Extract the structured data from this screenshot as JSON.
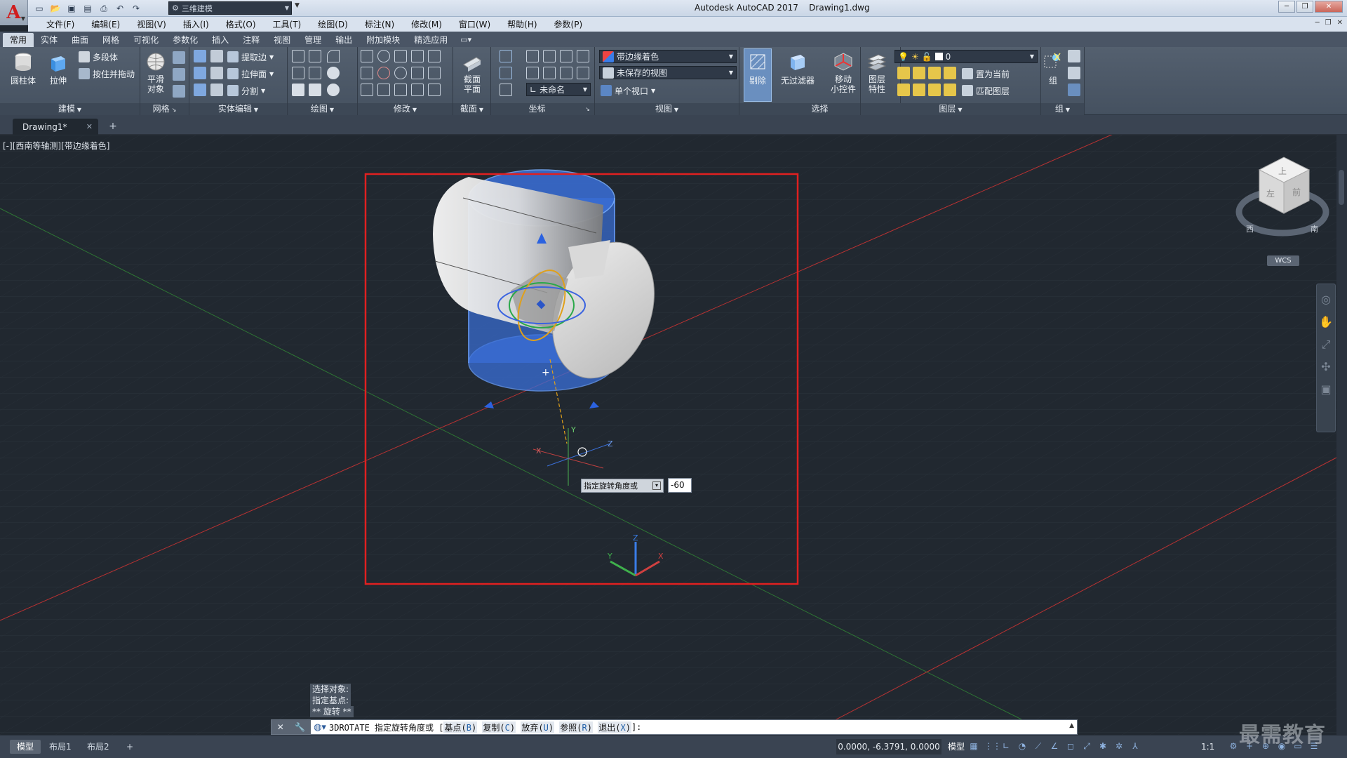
{
  "titlebar": {
    "logo": "A",
    "workspace": "三维建模",
    "title": "Autodesk AutoCAD 2017    Drawing1.dwg"
  },
  "menu": [
    "文件(F)",
    "编辑(E)",
    "视图(V)",
    "插入(I)",
    "格式(O)",
    "工具(T)",
    "绘图(D)",
    "标注(N)",
    "修改(M)",
    "窗口(W)",
    "帮助(H)",
    "参数(P)"
  ],
  "ribbon_tabs": [
    "常用",
    "实体",
    "曲面",
    "网格",
    "可视化",
    "参数化",
    "插入",
    "注释",
    "视图",
    "管理",
    "输出",
    "附加模块",
    "精选应用"
  ],
  "ribbon": {
    "modeling": {
      "title": "建模",
      "cylinder": "圆柱体",
      "extrude": "拉伸",
      "polysolid": "多段体",
      "presspull": "按住并拖动"
    },
    "mesh": {
      "title": "网格",
      "smooth": "平滑\n对象"
    },
    "solid_edit": {
      "title": "实体编辑",
      "extract_edges": "提取边",
      "extrude_faces": "拉伸面",
      "separate": "分割"
    },
    "draw": {
      "title": "绘图"
    },
    "modify": {
      "title": "修改"
    },
    "section": {
      "title": "截面",
      "section_plane": "截面\n平面"
    },
    "coordinates": {
      "title": "坐标",
      "ucs_combo": "未命名"
    },
    "view": {
      "title": "视图",
      "visual_style": "带边缘着色",
      "saved_view": "未保存的视图",
      "single_viewport": "单个视口"
    },
    "selection": {
      "title": "选择",
      "cull": "剔除",
      "no_filter": "无过滤器"
    },
    "gizmo": {
      "move_gizmo": "移动\n小控件"
    },
    "layers": {
      "title": "图层",
      "layer_props": "图层\n特性",
      "layer_combo": "0",
      "set_current": "置为当前",
      "match_layer": "匹配图层"
    },
    "groups": {
      "title": "组",
      "group": "组"
    }
  },
  "doc_tab": {
    "name": "Drawing1*"
  },
  "viewport": {
    "label": "[-][西南等轴测][带边缘着色]",
    "wcs": "WCS",
    "ucs_axes": {
      "x": "X",
      "y": "Y",
      "z": "Z"
    },
    "viewcube": {
      "top": "上",
      "front": "前",
      "left": "左",
      "west": "西",
      "south": "南"
    }
  },
  "dynamic_input": {
    "prompt": "指定旋转角度或",
    "value": "-60"
  },
  "command_history": [
    "选择对象:",
    "指定基点:",
    "** 旋转 **"
  ],
  "command_line": {
    "prefix": "3DROTATE 指定旋转角度或 [",
    "options": [
      {
        "label": "基点(",
        "key": "B",
        "end": ")"
      },
      {
        "label": "复制(",
        "key": "C",
        "end": ")"
      },
      {
        "label": "放弃(",
        "key": "U",
        "end": ")"
      },
      {
        "label": "参照(",
        "key": "R",
        "end": ")"
      },
      {
        "label": "退出(",
        "key": "X",
        "end": ")"
      }
    ],
    "suffix": "]:"
  },
  "layout_tabs": [
    "模型",
    "布局1",
    "布局2"
  ],
  "status": {
    "coords": "0.0000, -6.3791, 0.0000",
    "model": "模型",
    "scale": "1:1"
  },
  "watermark": "最需教育",
  "colors": {
    "highlight_frame": "#e02020",
    "selection_blue": "#3a7de8",
    "ribbon_bg": "#4d5868",
    "viewport_bg": "#212830"
  }
}
